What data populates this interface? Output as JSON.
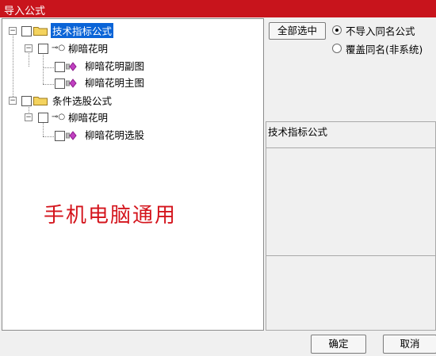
{
  "window": {
    "title": "导入公式"
  },
  "tree": {
    "group1": {
      "label": "技术指标公式",
      "formula": {
        "label": "柳暗花明",
        "children": [
          "柳暗花明副图",
          "柳暗花明主图"
        ]
      }
    },
    "group2": {
      "label": "条件选股公式",
      "formula": {
        "label": "柳暗花明",
        "children": [
          "柳暗花明选股"
        ]
      }
    }
  },
  "watermark": "手机电脑通用",
  "controls": {
    "select_all": "全部选中",
    "radio_skip": "不导入同名公式",
    "radio_overwrite": "覆盖同名(非系统)"
  },
  "info": {
    "title": "技术指标公式"
  },
  "footer": {
    "ok": "确定",
    "cancel": "取消"
  },
  "colors": {
    "title_bar": "#c8141c",
    "selection": "#0a64d7",
    "watermark": "#d4141c"
  }
}
